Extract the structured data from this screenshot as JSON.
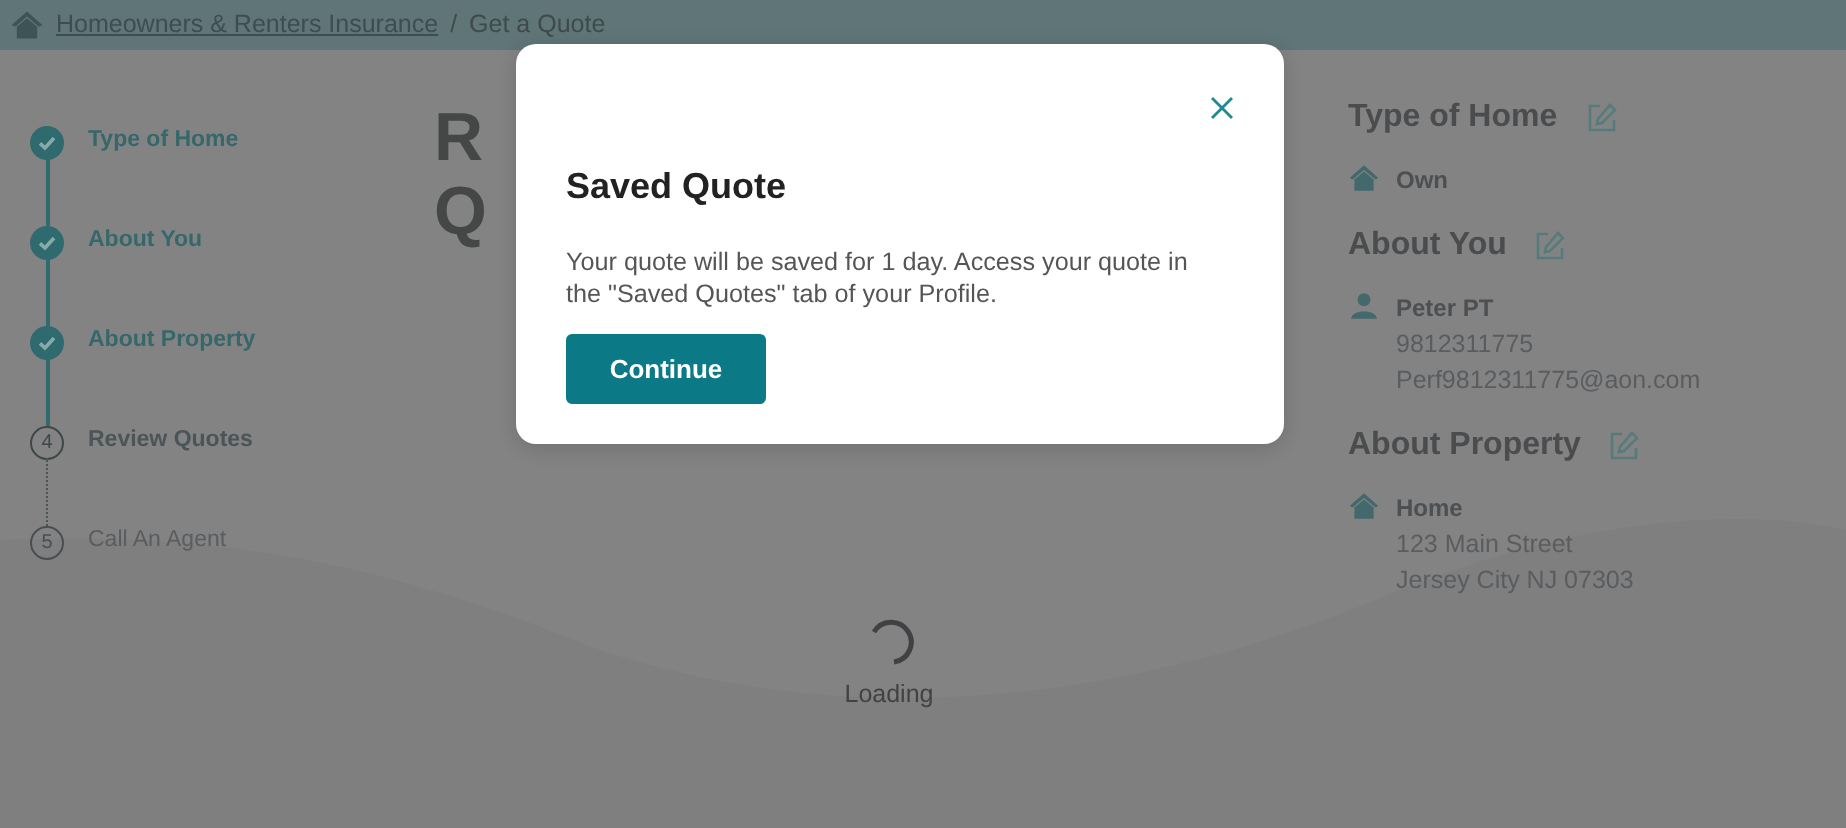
{
  "breadcrumb": {
    "link": "Homeowners & Renters Insurance",
    "separator": "/",
    "current": "Get a Quote"
  },
  "steps": [
    {
      "label": "Type of Home",
      "kind": "done"
    },
    {
      "label": "About You",
      "kind": "done"
    },
    {
      "label": "About Property",
      "kind": "done"
    },
    {
      "number": "4",
      "label": "Review Quotes",
      "kind": "current"
    },
    {
      "number": "5",
      "label": "Call An Agent",
      "kind": "upcoming"
    }
  ],
  "heading_lines": [
    "R",
    "Q"
  ],
  "loading": {
    "label": "Loading"
  },
  "summary": [
    {
      "title": "Type of Home",
      "kind": "home",
      "primary": "Own"
    },
    {
      "title": "About You",
      "kind": "person",
      "primary": "Peter PT",
      "details": [
        "9812311775",
        "Perf9812311775@aon.com"
      ]
    },
    {
      "title": "About Property",
      "kind": "home",
      "primary": "Home",
      "details": [
        "123 Main Street",
        "Jersey City NJ 07303"
      ]
    }
  ],
  "modal": {
    "title": "Saved Quote",
    "message": "Your quote will be saved for 1 day. Access your quote in the \"Saved Quotes\" tab of your Profile.",
    "button": "Continue"
  }
}
